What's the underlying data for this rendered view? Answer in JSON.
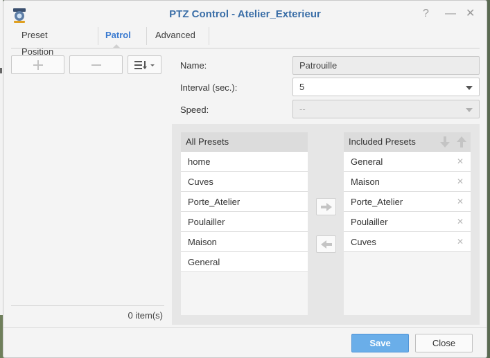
{
  "window": {
    "title": "PTZ Control - Atelier_Exterieur",
    "help_glyph": "?",
    "minimize_glyph": "—",
    "close_glyph": "✕"
  },
  "tabs": [
    {
      "label": "Preset Position",
      "active": false
    },
    {
      "label": "Patrol",
      "active": true
    },
    {
      "label": "Advanced",
      "active": false
    }
  ],
  "toolbar": {
    "add_icon": "plus-icon",
    "remove_icon": "minus-icon",
    "sort_icon": "sort-list-icon"
  },
  "patrol_list": {
    "items": [],
    "count_text": "0 item(s)"
  },
  "form": {
    "name_label": "Name:",
    "name_value": "Patrouille",
    "interval_label": "Interval (sec.):",
    "interval_value": "5",
    "speed_label": "Speed:",
    "speed_value": "--"
  },
  "all_presets": {
    "header": "All Presets",
    "items": [
      "home",
      "Cuves",
      "Porte_Atelier",
      "Poulailler",
      "Maison",
      "General"
    ]
  },
  "included_presets": {
    "header": "Included Presets",
    "items": [
      "General",
      "Maison",
      "Porte_Atelier",
      "Poulailler",
      "Cuves"
    ],
    "remove_glyph": "✕"
  },
  "buttons": {
    "save": "Save",
    "close": "Close"
  },
  "colors": {
    "title": "#3a6ea7",
    "active_tab": "#3a7ad0",
    "save_button": "#6aaee9"
  }
}
